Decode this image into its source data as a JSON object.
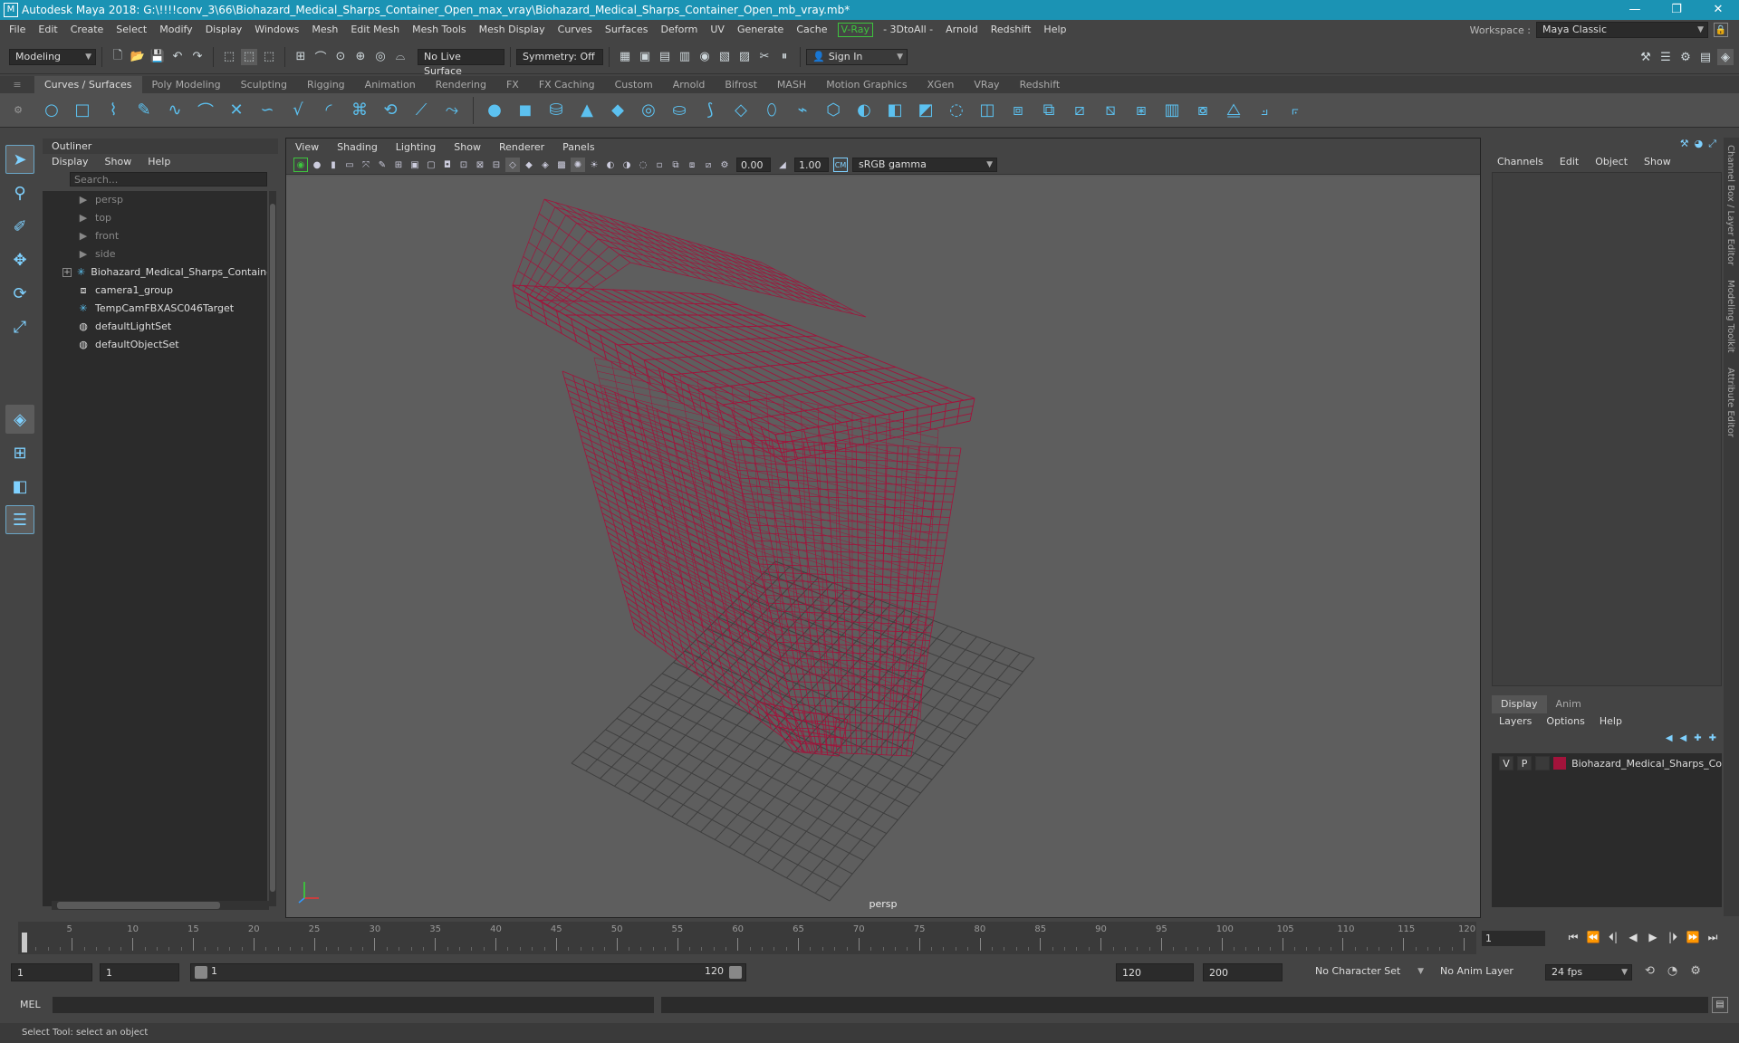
{
  "title_bar": {
    "app_icon": "M",
    "title": "Autodesk Maya 2018: G:\\!!!!conv_3\\66\\Biohazard_Medical_Sharps_Container_Open_max_vray\\Biohazard_Medical_Sharps_Container_Open_mb_vray.mb*",
    "minimize": "—",
    "maximize": "❐",
    "close": "✕"
  },
  "menu_bar": {
    "items": [
      "File",
      "Edit",
      "Create",
      "Select",
      "Modify",
      "Display",
      "Windows",
      "Mesh",
      "Edit Mesh",
      "Mesh Tools",
      "Mesh Display",
      "Curves",
      "Surfaces",
      "Deform",
      "UV",
      "Generate",
      "Cache"
    ],
    "vray": "V-Ray",
    "items2": [
      "- 3DtoAll -",
      "Arnold",
      "Redshift",
      "Help"
    ],
    "workspace_label": "Workspace :",
    "workspace_value": "Maya Classic"
  },
  "status_line": {
    "mode": "Modeling",
    "live_surface": "No Live Surface",
    "symmetry": "Symmetry: Off",
    "sign_in": "Sign In"
  },
  "shelf": {
    "tabs": [
      "Curves / Surfaces",
      "Poly Modeling",
      "Sculpting",
      "Rigging",
      "Animation",
      "Rendering",
      "FX",
      "FX Caching",
      "Custom",
      "Arnold",
      "Bifrost",
      "MASH",
      "Motion Graphics",
      "XGen",
      "VRay",
      "Redshift"
    ],
    "active_tab": 0
  },
  "outliner": {
    "title": "Outliner",
    "menu": [
      "Display",
      "Show",
      "Help"
    ],
    "search_placeholder": "Search...",
    "items": [
      {
        "label": "persp",
        "icon": "camera-icon",
        "dim": true
      },
      {
        "label": "top",
        "icon": "camera-icon",
        "dim": true
      },
      {
        "label": "front",
        "icon": "camera-icon",
        "dim": true
      },
      {
        "label": "side",
        "icon": "camera-icon",
        "dim": true
      },
      {
        "label": "Biohazard_Medical_Sharps_Containe",
        "icon": "transform-icon",
        "dim": false,
        "expand": "+"
      },
      {
        "label": "camera1_group",
        "icon": "group-icon",
        "dim": false
      },
      {
        "label": "TempCamFBXASC046Target",
        "icon": "transform-icon",
        "dim": false
      },
      {
        "label": "defaultLightSet",
        "icon": "set-icon",
        "dim": false
      },
      {
        "label": "defaultObjectSet",
        "icon": "set-icon",
        "dim": false
      }
    ]
  },
  "viewport": {
    "menu": [
      "View",
      "Shading",
      "Lighting",
      "Show",
      "Renderer",
      "Panels"
    ],
    "exposure": "0.00",
    "gamma": "1.00",
    "color_space": "sRGB gamma",
    "camera_label": "persp",
    "wire_color": "#a3133b",
    "grid_color": "#3f3f3f"
  },
  "channel_box": {
    "menu": [
      "Channels",
      "Edit",
      "Object",
      "Show"
    ]
  },
  "side_tabs": [
    "Channel Box / Layer Editor",
    "Modeling Toolkit",
    "Attribute Editor"
  ],
  "layer_editor": {
    "tabs": [
      "Display",
      "Anim"
    ],
    "menu": [
      "Layers",
      "Options",
      "Help"
    ],
    "layer": {
      "v": "V",
      "p": "P",
      "name": "Biohazard_Medical_Sharps_Co",
      "color": "#a3133b"
    }
  },
  "time_slider": {
    "ticks": [
      1,
      5,
      10,
      15,
      20,
      25,
      30,
      35,
      40,
      45,
      50,
      55,
      60,
      65,
      70,
      75,
      80,
      85,
      90,
      95,
      100,
      105,
      110,
      115,
      120
    ],
    "current_frame": "1",
    "playback": [
      "⏮",
      "⏪",
      "⏴|",
      "◀",
      "▶",
      "|⏵",
      "⏩",
      "⏭"
    ]
  },
  "range_slider": {
    "start_time": "1",
    "playback_start": "1",
    "range_start": "1",
    "range_end": "120",
    "playback_end": "120",
    "end_time": "200",
    "character_set": "No Character Set",
    "anim_layer": "No Anim Layer",
    "fps": "24 fps"
  },
  "command_line": {
    "label": "MEL"
  },
  "help_line": {
    "text": "Select Tool: select an object"
  }
}
